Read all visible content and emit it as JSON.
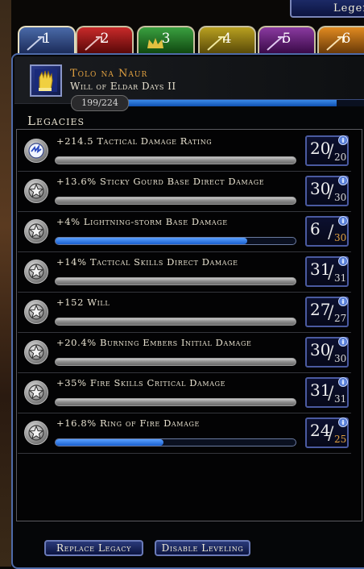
{
  "window": {
    "title": "Legen"
  },
  "tabs": [
    {
      "label": "1",
      "color": "#2c4a8a"
    },
    {
      "label": "2",
      "color": "#a01818"
    },
    {
      "label": "3",
      "color": "#2a8a30"
    },
    {
      "label": "4",
      "color": "#a08a10"
    },
    {
      "label": "5",
      "color": "#702a88"
    },
    {
      "label": "6",
      "color": "#c87818"
    }
  ],
  "item": {
    "name": "Tolo na Naur",
    "subtitle": "Will of Eldar Days II",
    "icon": "glove-icon",
    "xp_label": "199/224",
    "xp_fraction": 0.89
  },
  "legacies": {
    "title": "Legacies",
    "rows": [
      {
        "label": "+214.5 Tactical Damage Rating",
        "rank": "20",
        "max": "20",
        "progress": 1.0,
        "icon": "lightning-swirl-icon",
        "maxed": true
      },
      {
        "label": "+13.6% Sticky Gourd Base Direct Damage",
        "rank": "30",
        "max": "30",
        "progress": 1.0,
        "icon": "star-medallion-icon",
        "maxed": true
      },
      {
        "label": "+4% Lightning-storm Base Damage",
        "rank": "6",
        "max": "30",
        "progress": 0.8,
        "icon": "star-medallion-icon",
        "maxed": false
      },
      {
        "label": "+14% Tactical Skills Direct Damage",
        "rank": "31",
        "max": "31",
        "progress": 1.0,
        "icon": "star-medallion-icon",
        "maxed": true
      },
      {
        "label": "+152 Will",
        "rank": "27",
        "max": "27",
        "progress": 1.0,
        "icon": "star-medallion-icon",
        "maxed": true
      },
      {
        "label": "+20.4% Burning Embers Initial Damage",
        "rank": "30",
        "max": "30",
        "progress": 1.0,
        "icon": "star-medallion-icon",
        "maxed": true
      },
      {
        "label": "+35% Fire Skills Critical Damage",
        "rank": "31",
        "max": "31",
        "progress": 1.0,
        "icon": "star-medallion-icon",
        "maxed": true
      },
      {
        "label": "+16.8% Ring of Fire Damage",
        "rank": "24",
        "max": "25",
        "progress": 0.45,
        "icon": "star-medallion-icon",
        "maxed": false
      }
    ]
  },
  "buttons": {
    "replace_legacy": "Replace Legacy",
    "disable_leveling": "Disable Leveling"
  },
  "colors": {
    "max_rank_color": "#d8d8d8",
    "partial_rank_color": "#e0a040",
    "xp_bar": "#2a70e0"
  }
}
